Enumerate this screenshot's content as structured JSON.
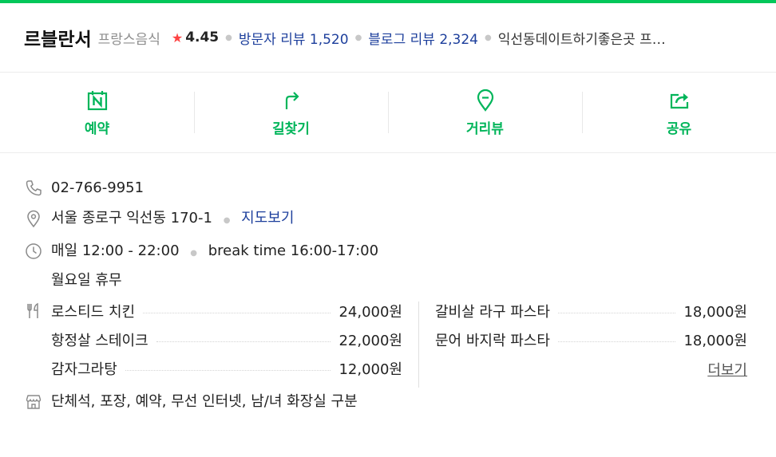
{
  "place": {
    "name": "르블란서",
    "category": "프랑스음식",
    "rating": "4.45",
    "visitor_reviews_label": "방문자 리뷰",
    "visitor_reviews_count": "1,520",
    "blog_reviews_label": "블로그 리뷰",
    "blog_reviews_count": "2,324",
    "tagline": "익선동데이트하기좋은곳 프…"
  },
  "actions": [
    {
      "label": "예약",
      "icon": "reserve-icon"
    },
    {
      "label": "길찾기",
      "icon": "directions-icon"
    },
    {
      "label": "거리뷰",
      "icon": "streetview-icon"
    },
    {
      "label": "공유",
      "icon": "share-icon"
    }
  ],
  "info": {
    "phone": "02-766-9951",
    "address": "서울 종로구 익선동 170-1",
    "map_link": "지도보기",
    "hours": "매일 12:00 - 22:00",
    "break_time": "break time 16:00-17:00",
    "holiday": "월요일 휴무",
    "facilities": "단체석, 포장, 예약, 무선 인터넷, 남/녀 화장실 구분",
    "more_label": "더보기"
  },
  "menu": {
    "left": [
      {
        "name": "로스티드 치킨",
        "price": "24,000원"
      },
      {
        "name": "항정살 스테이크",
        "price": "22,000원"
      },
      {
        "name": "감자그라탕",
        "price": "12,000원"
      }
    ],
    "right": [
      {
        "name": "갈비살 라구 파스타",
        "price": "18,000원"
      },
      {
        "name": "문어 바지락 파스타",
        "price": "18,000원"
      }
    ]
  },
  "colors": {
    "accent": "#03c75a",
    "action_text": "#00b55a",
    "link": "#1d3f9c",
    "star": "#fe4343"
  }
}
